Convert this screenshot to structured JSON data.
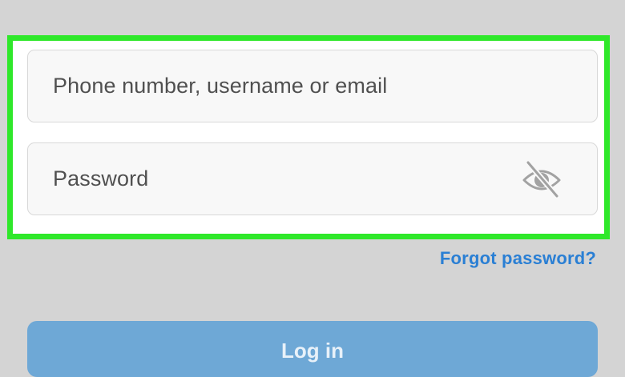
{
  "login_form": {
    "username_placeholder": "Phone number, username or email",
    "password_placeholder": "Password",
    "password_toggle_icon": "eye-slash-icon",
    "forgot_password_label": "Forgot password?",
    "login_button_label": "Log in"
  },
  "colors": {
    "highlight_border": "#2fe82a",
    "background": "#d4d4d4",
    "link": "#2a7fd4",
    "button": "#6ea8d6"
  }
}
